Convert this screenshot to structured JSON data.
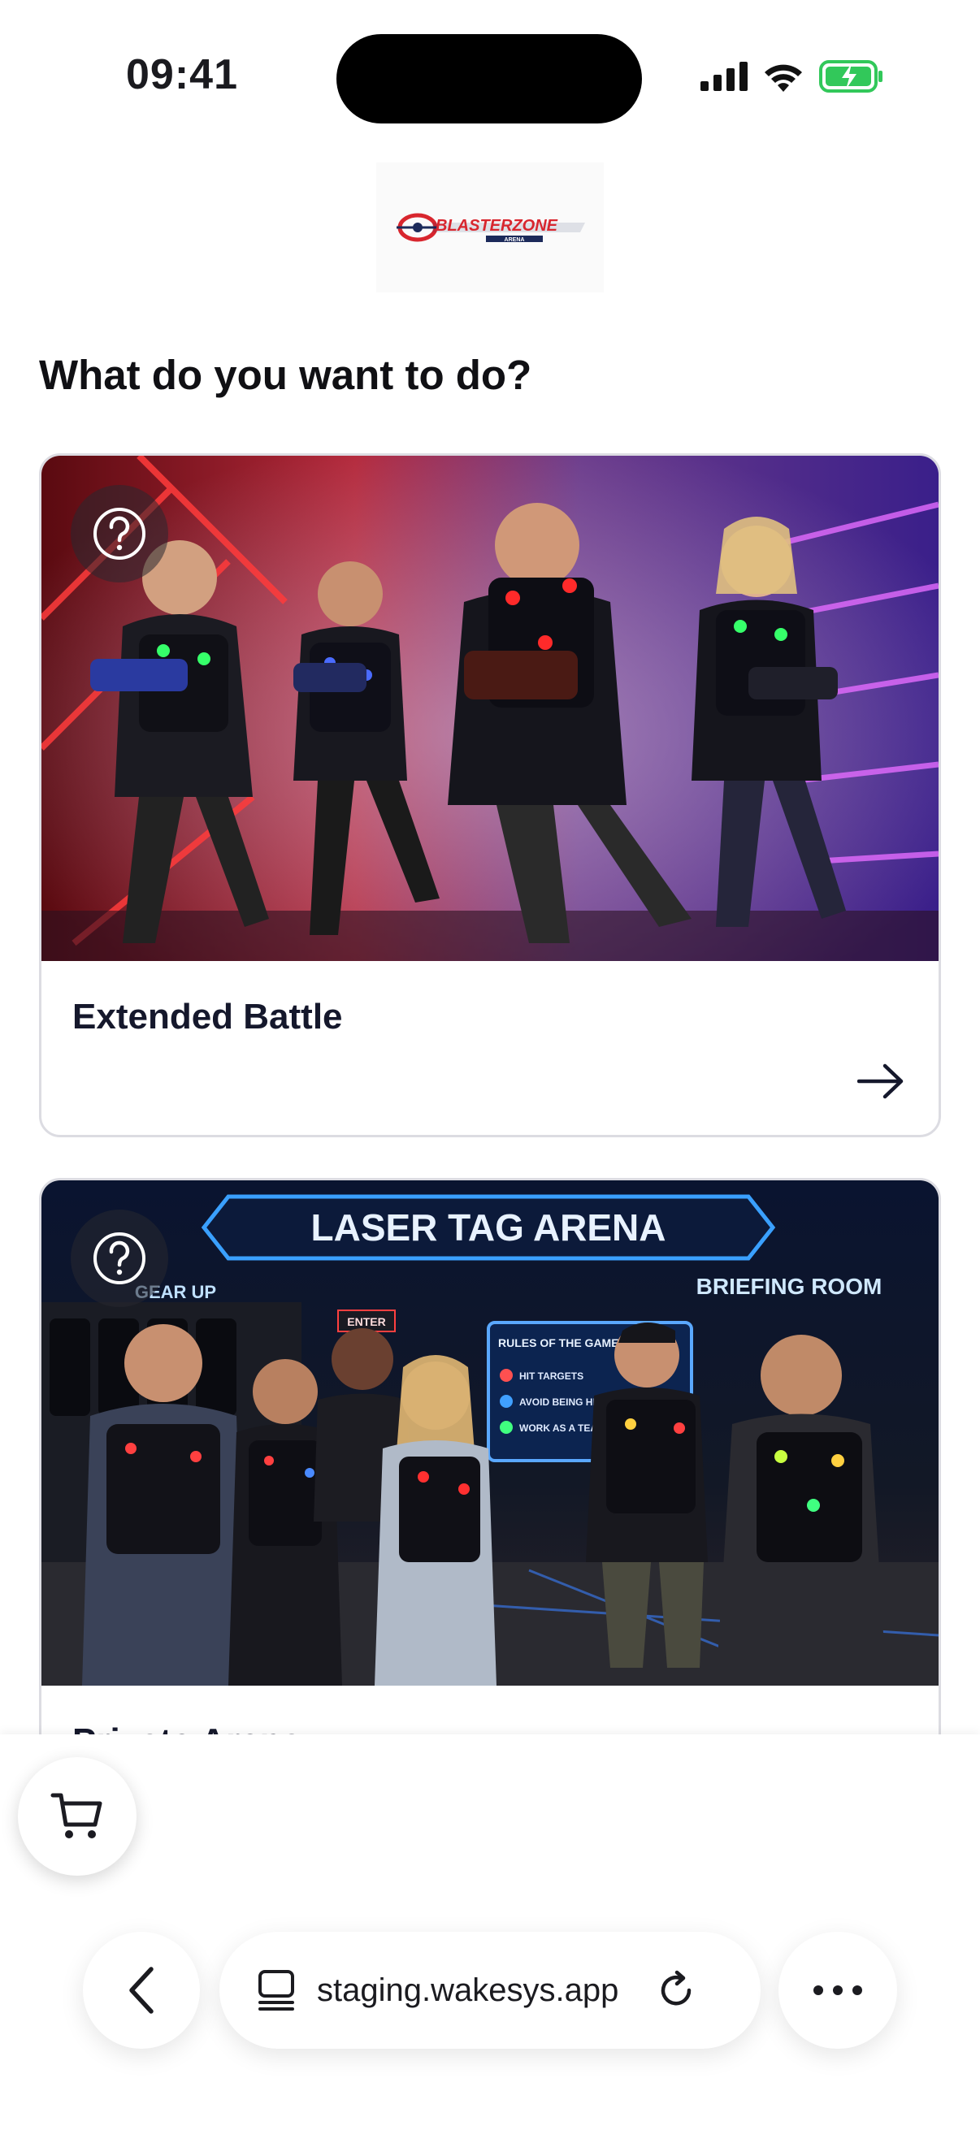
{
  "status_bar": {
    "time": "09:41",
    "icons": [
      "signal-icon",
      "wifi-icon",
      "battery-charging-icon"
    ]
  },
  "brand": {
    "logo_text": "BLASTERZONE",
    "logo_subtext": "ARENA",
    "colors": {
      "red": "#d8262e",
      "navy": "#1c2a5a"
    }
  },
  "page": {
    "heading": "What do you want to do?"
  },
  "activities": [
    {
      "title": "Extended Battle",
      "help_icon": "question-circle-icon",
      "arrow_icon": "arrow-right-icon"
    },
    {
      "title": "Private Arena",
      "help_icon": "question-circle-icon",
      "image_texts": {
        "banner": "LASER TAG ARENA",
        "sign_left": "GEAR UP",
        "sign_right": "BRIEFING ROOM",
        "door": "ENTER",
        "screen_title": "RULES OF THE GAME",
        "screen_items": [
          "HIT TARGETS",
          "AVOID BEING HIT",
          "WORK AS A TEAM"
        ]
      }
    }
  ],
  "cart": {
    "icon": "cart-icon"
  },
  "browser": {
    "url": "staging.wakesys.app",
    "back_icon": "chevron-left-icon",
    "tabs_icon": "tab-view-icon",
    "reload_icon": "reload-icon",
    "more_icon": "more-horizontal-icon"
  }
}
